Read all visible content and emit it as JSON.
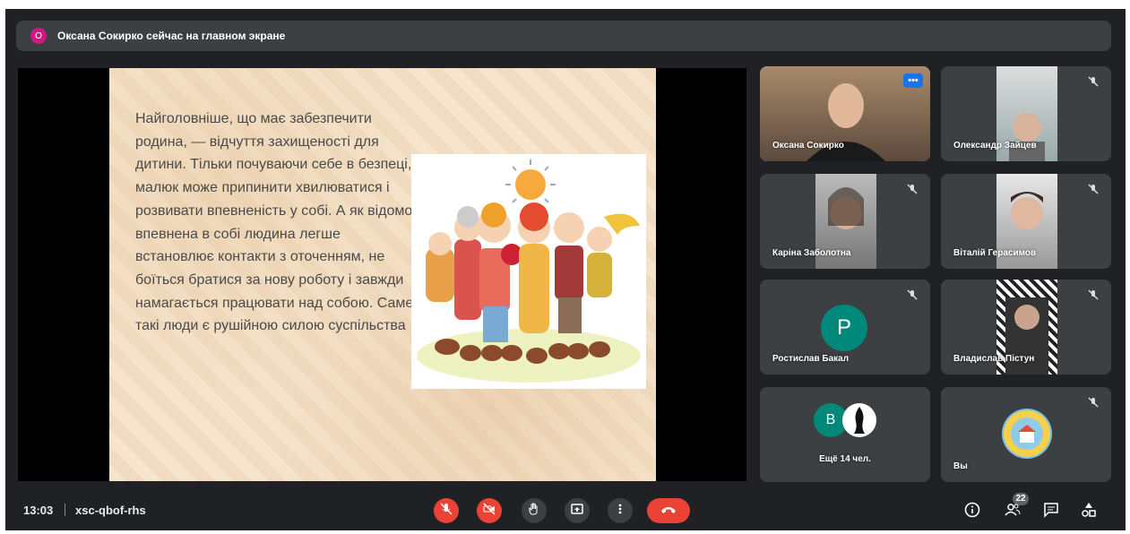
{
  "banner": {
    "avatar_letter": "O",
    "text": "Оксана Сокирко сейчас на главном экране"
  },
  "slide": {
    "text": "Найголовніше, що має забезпечити родина, — відчуття захищеності для дитини. Тільки почуваючи себе в безпеці, малюк може припинити хвилюватися і розвивати впевненість у собі. А як відомо, впевнена в собі людина легше встановлює контакти з оточенням, не боїться братися за нову роботу і завжди намагається працювати над собою. Саме такі люди є рушійною силою суспільства"
  },
  "participants": [
    {
      "name": "Оксана Сокирко",
      "speaking": true,
      "more_label": "•••"
    },
    {
      "name": "Олександр Зайцев"
    },
    {
      "name": "Каріна Заболотна"
    },
    {
      "name": "Віталій Герасимов"
    },
    {
      "name": "Ростислав Бакал",
      "avatar_letter": "P",
      "avatar_color": "#00897b"
    },
    {
      "name": "Владислав Пістун"
    },
    {
      "name": "Ещё 14 чел.",
      "avatar_letter": "B",
      "avatar_color": "#00897b"
    },
    {
      "name": "Вы"
    }
  ],
  "bottom": {
    "time": "13:03",
    "meeting_code": "xsc-qbof-rhs",
    "people_count": "22"
  },
  "icons": {
    "mic_off": "mic-off-icon",
    "camera_off": "camera-off-icon",
    "raise_hand": "hand-icon",
    "present": "present-icon",
    "more": "more-vert-icon",
    "leave": "call-end-icon",
    "info": "info-icon",
    "people": "people-icon",
    "chat": "chat-icon",
    "activities": "activities-icon"
  },
  "colors": {
    "background": "#202124",
    "tile": "#3c4043",
    "danger": "#ea4335",
    "accent": "#1a73e8"
  }
}
